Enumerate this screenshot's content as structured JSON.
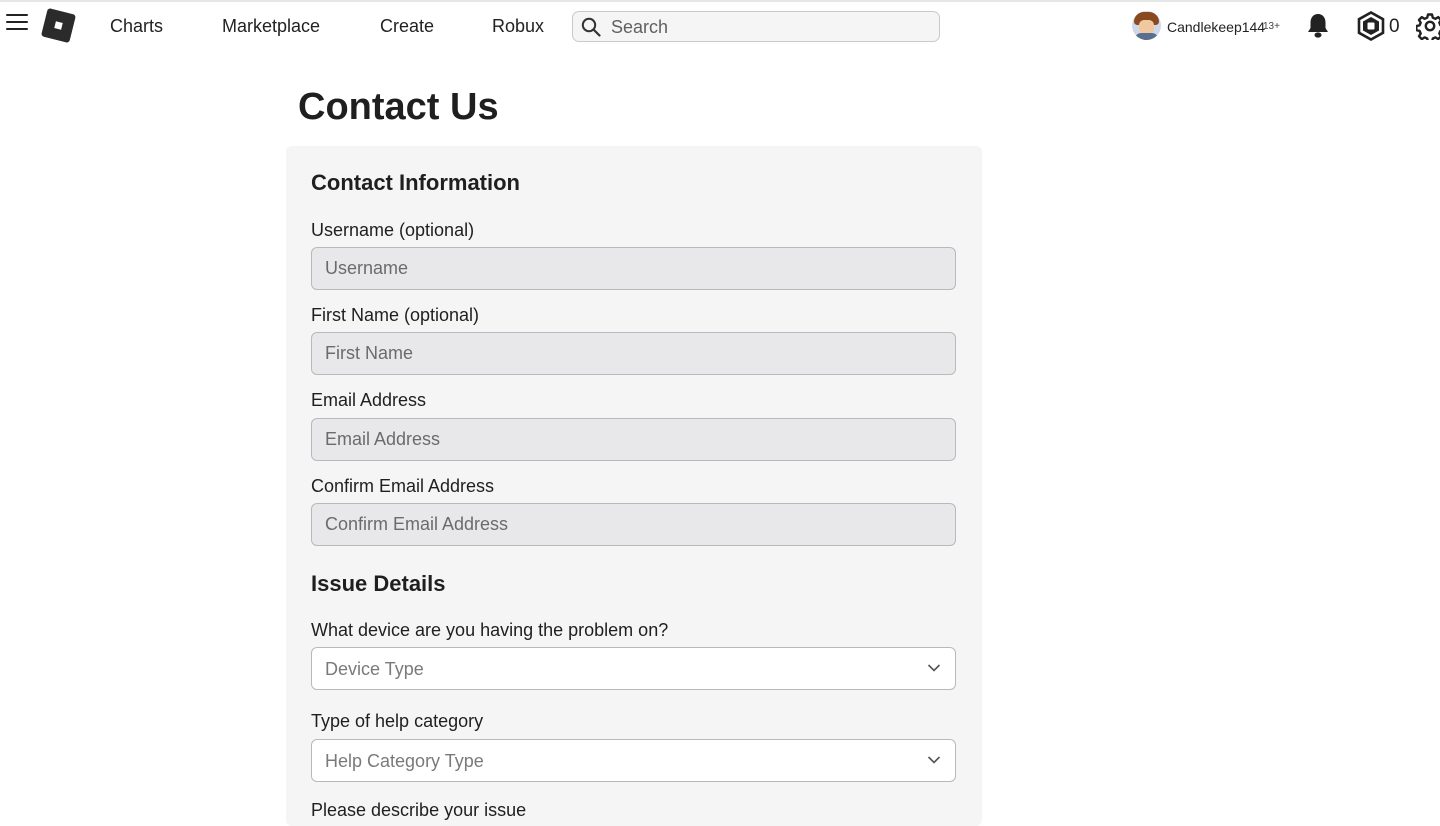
{
  "nav": {
    "links": [
      "Charts",
      "Marketplace",
      "Create",
      "Robux"
    ],
    "search_placeholder": "Search",
    "user": {
      "name": "Candlekeep144",
      "age_badge": "13+"
    },
    "robux_count": "0",
    "icons": [
      "menu-icon",
      "roblox-logo",
      "search-icon",
      "bell-icon",
      "robux-icon",
      "gear-icon"
    ]
  },
  "page": {
    "title": "Contact Us"
  },
  "contact_info": {
    "heading": "Contact Information",
    "fields": [
      {
        "label": "Username (optional)",
        "placeholder": "Username"
      },
      {
        "label": "First Name (optional)",
        "placeholder": "First Name"
      },
      {
        "label": "Email Address",
        "placeholder": "Email Address"
      },
      {
        "label": "Confirm Email Address",
        "placeholder": "Confirm Email Address"
      }
    ]
  },
  "issue_details": {
    "heading": "Issue Details",
    "device": {
      "label": "What device are you having the problem on?",
      "selected": "Device Type"
    },
    "category": {
      "label": "Type of help category",
      "selected": "Help Category Type"
    },
    "next_label_partial": "Please describe your issue"
  },
  "colors": {
    "panel_background": "#f5f5f5",
    "input_background": "#e8e8ea",
    "input_border": "#b9b9bd",
    "text": "#1f1f1f"
  }
}
